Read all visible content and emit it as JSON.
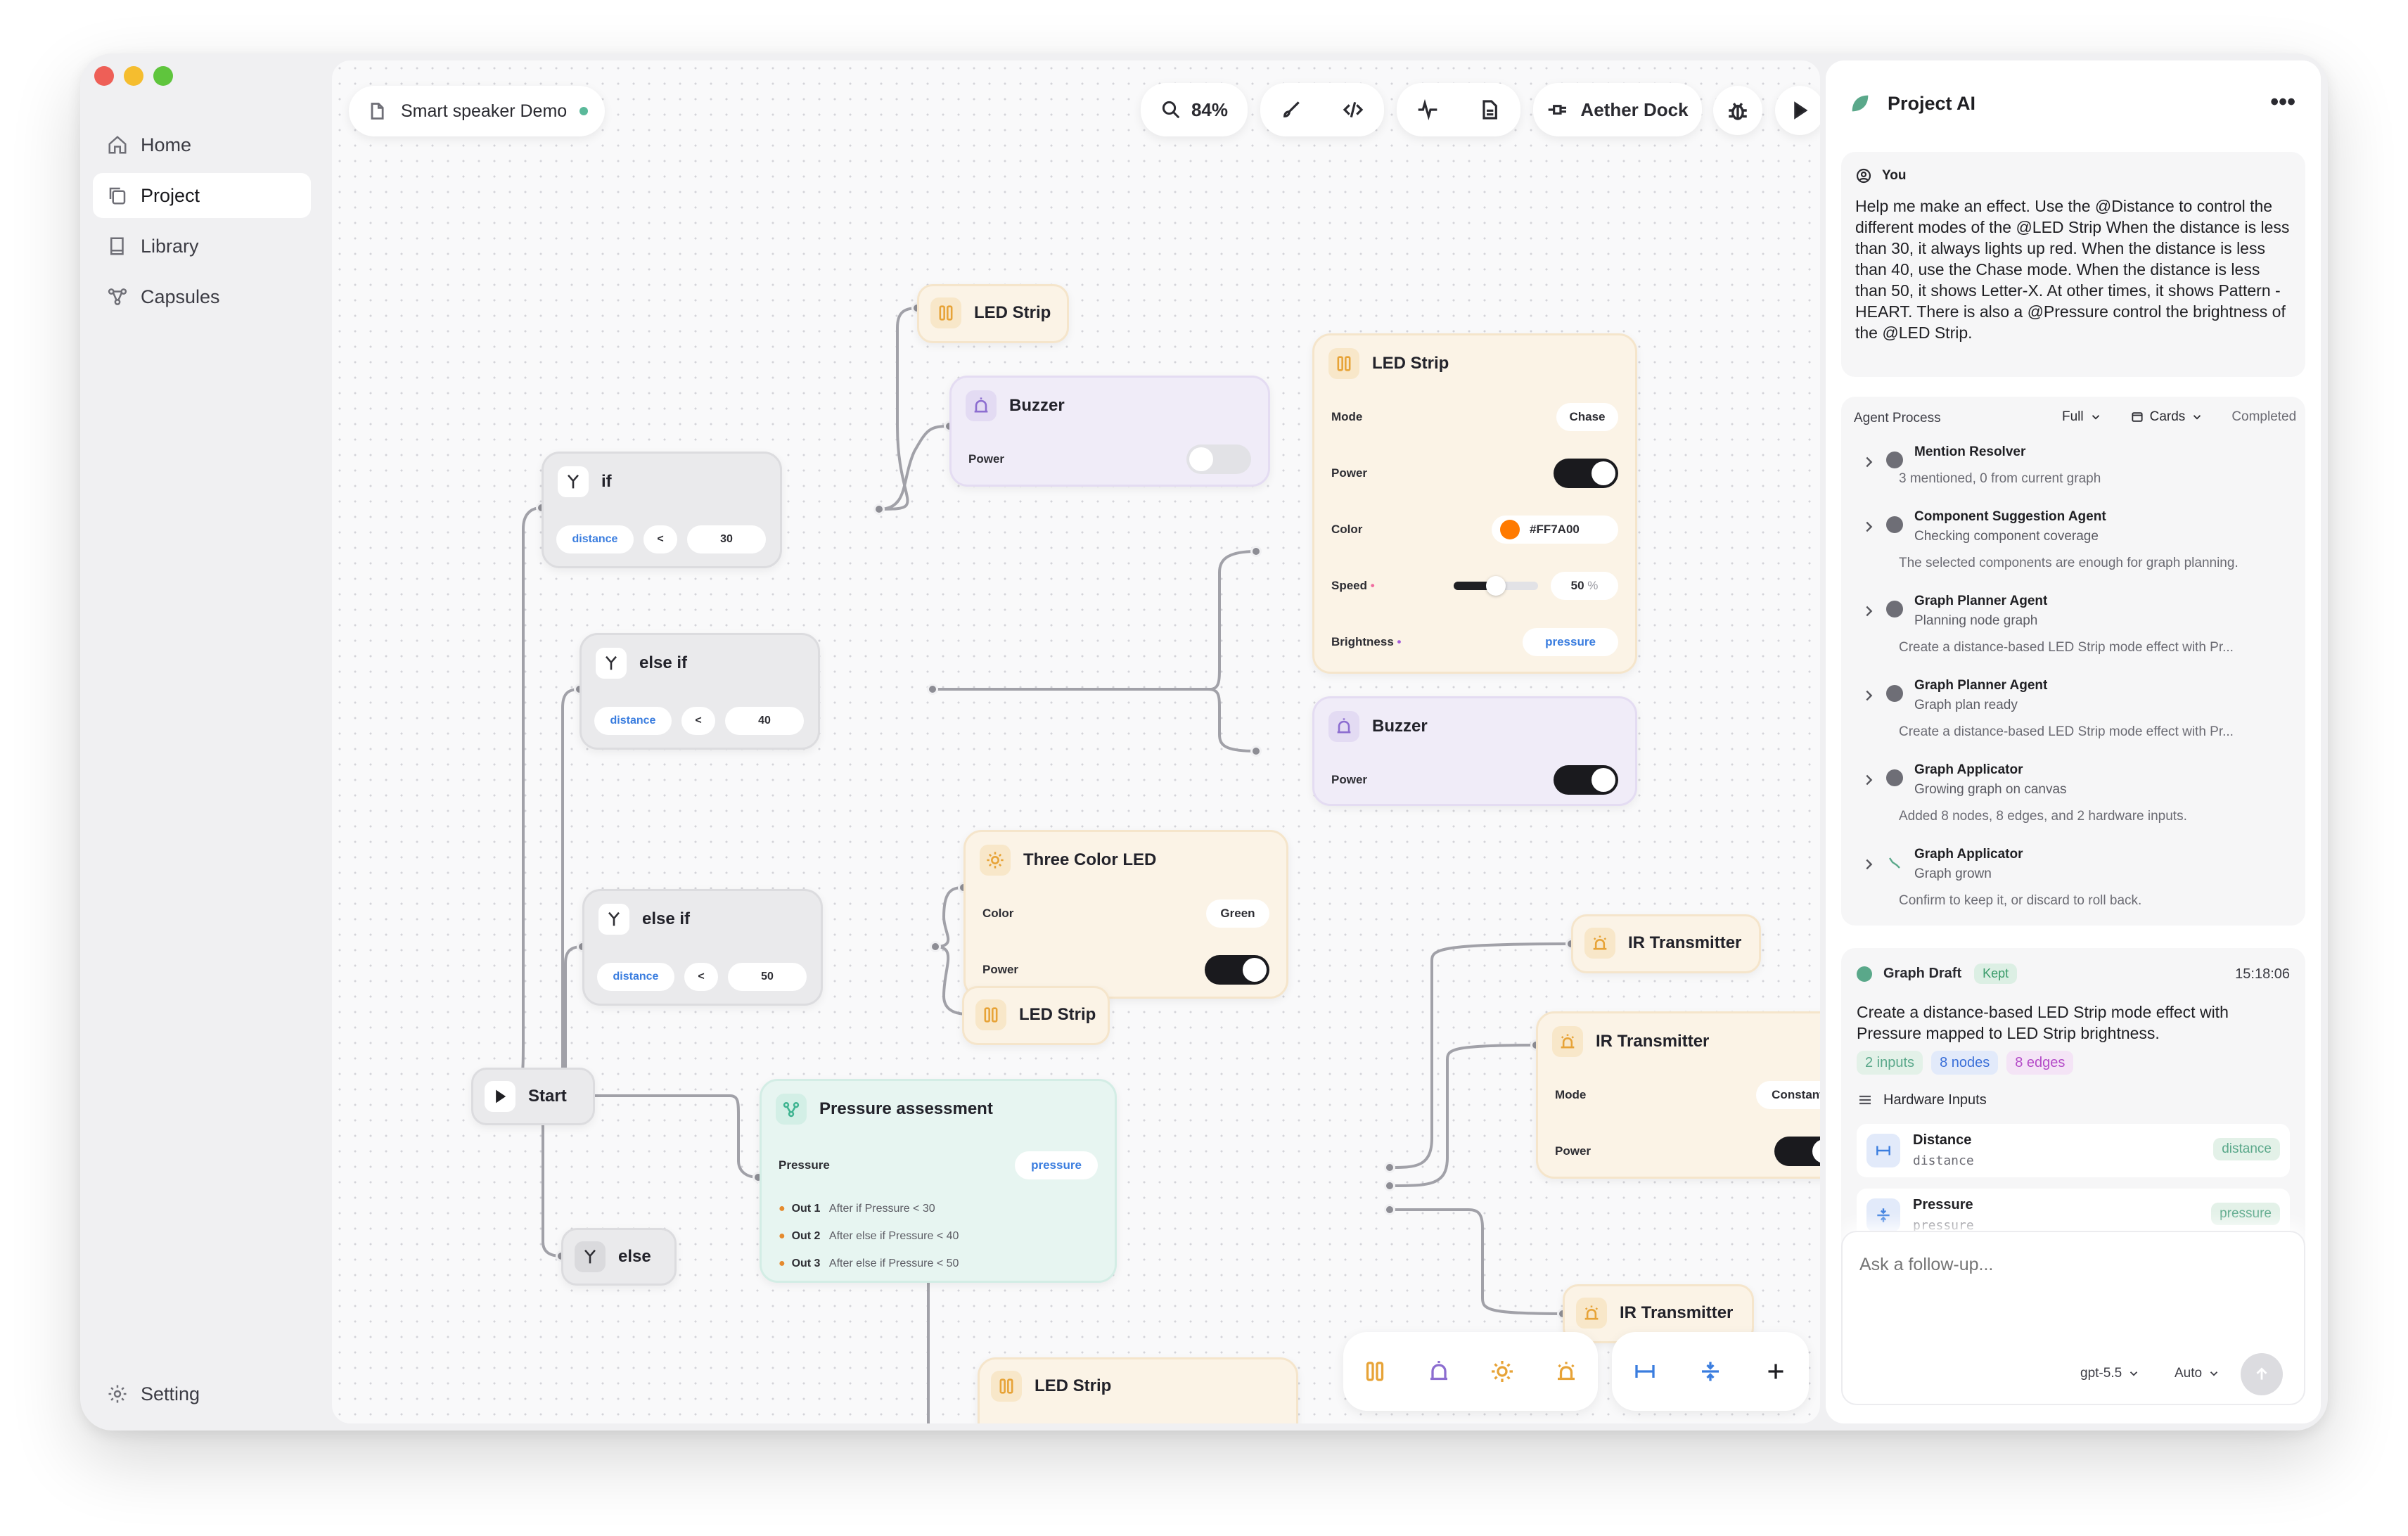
{
  "sidebar": {
    "items": [
      {
        "label": "Home",
        "icon": "home-icon"
      },
      {
        "label": "Project",
        "icon": "copy-icon"
      },
      {
        "label": "Library",
        "icon": "book-icon"
      },
      {
        "label": "Capsules",
        "icon": "graph-icon"
      }
    ],
    "active": "Project",
    "setting_label": "Setting"
  },
  "toolbar": {
    "project_name": "Smart speaker Demo",
    "zoom": "84%",
    "device_name": "Aether Dock"
  },
  "canvas": {
    "nodes": {
      "start": {
        "label": "Start"
      },
      "if1": {
        "label": "if",
        "var": "distance",
        "op": "<",
        "value": "30"
      },
      "elseif1": {
        "label": "else if",
        "var": "distance",
        "op": "<",
        "value": "40"
      },
      "elseif2": {
        "label": "else if",
        "var": "distance",
        "op": "<",
        "value": "50"
      },
      "else1": {
        "label": "else"
      },
      "led_top": {
        "label": "LED Strip"
      },
      "buzzer1": {
        "label": "Buzzer",
        "power_label": "Power",
        "power_on": false
      },
      "led_main": {
        "label": "LED Strip",
        "mode_label": "Mode",
        "mode_value": "Chase",
        "power_label": "Power",
        "power_on": true,
        "color_label": "Color",
        "color_value": "#FF7A00",
        "speed_label": "Speed",
        "speed_value": "50",
        "speed_unit": "%",
        "speed_fraction": 0.5,
        "brightness_label": "Brightness",
        "brightness_value": "pressure"
      },
      "buzzer2": {
        "label": "Buzzer",
        "power_label": "Power",
        "power_on": true
      },
      "three_color": {
        "label": "Three Color LED",
        "color_label": "Color",
        "color_value": "Green",
        "power_label": "Power",
        "power_on": true
      },
      "led_mid": {
        "label": "LED Strip"
      },
      "pressure": {
        "label": "Pressure assessment",
        "input_label": "Pressure",
        "input_value": "pressure",
        "outputs": [
          {
            "name": "Out 1",
            "desc": "After if Pressure < 30"
          },
          {
            "name": "Out 2",
            "desc": "After else if Pressure < 40"
          },
          {
            "name": "Out 3",
            "desc": "After else if Pressure < 50"
          }
        ]
      },
      "ir1": {
        "label": "IR Transmitter"
      },
      "ir2": {
        "label": "IR Transmitter",
        "mode_label": "Mode",
        "mode_value": "Constant",
        "power_label": "Power",
        "power_on": true
      },
      "ir3": {
        "label": "IR Transmitter"
      },
      "led_bottom": {
        "label": "LED Strip"
      }
    }
  },
  "panel": {
    "title": "Project AI",
    "user_label": "You",
    "user_message": "Help me make an effect. Use the @Distance    to control the different modes of the @LED Strip  When the distance is less than 30, it always lights up red. When the distance is less than 40, use the Chase mode. When the distance is less than 50, it shows Letter-X. At other times, it shows Pattern - HEART. There is also a @Pressure  control the brightness of the @LED Strip.",
    "process": {
      "title": "Agent Process",
      "view_full": "Full",
      "view_cards": "Cards",
      "status": "Completed",
      "steps": [
        {
          "title": "Mention Resolver",
          "sub": "",
          "desc": "3 mentioned, 0 from current graph",
          "done": true
        },
        {
          "title": "Component Suggestion Agent",
          "sub": "Checking component coverage",
          "desc": "The selected components are enough for graph planning.",
          "done": true
        },
        {
          "title": "Graph Planner Agent",
          "sub": "Planning node graph",
          "desc": "Create a distance-based LED Strip mode effect with Pr...",
          "done": true
        },
        {
          "title": "Graph Planner Agent",
          "sub": "Graph plan ready",
          "desc": "Create a distance-based LED Strip mode effect with Pr...",
          "done": true
        },
        {
          "title": "Graph Applicator",
          "sub": "Growing graph on canvas",
          "desc": "Added 8 nodes, 8 edges, and 2 hardware inputs.",
          "done": true
        },
        {
          "title": "Graph Applicator",
          "sub": "Graph grown",
          "desc": "Confirm to keep it, or discard to roll back.",
          "done": false
        }
      ]
    },
    "draft": {
      "title": "Graph Draft",
      "status": "Kept",
      "time": "15:18:06",
      "summary": "Create a distance-based LED Strip mode effect with Pressure mapped to LED Strip brightness.",
      "badges": [
        "2 inputs",
        "8 nodes",
        "8 edges"
      ],
      "hw_title": "Hardware Inputs",
      "inputs": [
        {
          "name": "Distance",
          "code": "distance",
          "tag": "distance"
        },
        {
          "name": "Pressure",
          "code": "pressure",
          "tag": "pressure"
        }
      ]
    },
    "composer": {
      "placeholder": "Ask a follow-up...",
      "model": "gpt-5.5",
      "mode": "Auto"
    }
  },
  "colors": {
    "accent_blue": "#3a7ddf",
    "led_color": "#FF7A00",
    "kept_green": "#3a9b6a",
    "nodes_badge": "#3a6fd8",
    "edges_badge": "#b44bc8"
  }
}
